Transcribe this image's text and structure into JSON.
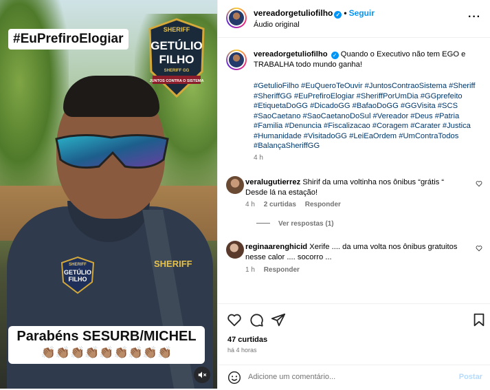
{
  "media": {
    "tag_top": "#EuPrefiroElogiar",
    "badge": {
      "top": "SHERIFF",
      "line1": "GETÚLIO",
      "line2": "FILHO",
      "middle": "SHERIFF GG",
      "bottom": "JUNTOS CONTRA O SISTEMA"
    },
    "shirt_text": "SHERIFF",
    "shirt_badge": {
      "top": "SHERIFF",
      "line1": "GETÚLIO",
      "line2": "FILHO"
    },
    "caption_line1": "Parabéns SESURB/MICHEL",
    "caption_line2": "👏🏽👏🏽👏🏽👏🏽👏🏽👏🏽👏🏽👏🏽👏🏽",
    "mute_icon": "muted-speaker-icon"
  },
  "header": {
    "username": "vereadorgetuliofilho",
    "follow_label": "Seguir",
    "subtitle": "Áudio original",
    "more_icon": "more-options-icon"
  },
  "post_caption": {
    "username": "vereadorgetuliofilho",
    "text": "Quando o Executivo não tem EGO e TRABALHA todo mundo ganha!",
    "hashtags": "#GetulioFilho #EuQueroTeOuvir #JuntosContraoSistema #Sheriff #SheriffGG #EuPrefiroElogiar #SheriffPorUmDia #GGprefeito #EtiquetaDoGG #DicadoGG #BafaoDoGG #GGVisita #SCS #SaoCaetano #SaoCaetanoDoSul #Vereador #Deus #Patria #Familia #Denuncia #Fiscalizacao #Coragem #Carater #Justica #Humanidade #VisitadoGG #LeiEaOrdem #UmContraTodos #BalançaSheriffGG",
    "time": "4 h"
  },
  "comments": [
    {
      "username": "veralugutierrez",
      "text": "Shirif da uma voltinha nos ônibus “grátis “ Desde lá na estação!",
      "time": "4 h",
      "likes": "2 curtidas",
      "reply_label": "Responder",
      "view_replies": "Ver respostas (1)"
    },
    {
      "username": "reginaarenghicid",
      "text": "Xerife .... da uma volta nos ônibus gratuitos nesse calor .... socorro ...",
      "time": "1 h",
      "reply_label": "Responder"
    }
  ],
  "actions": {
    "likes": "47 curtidas",
    "post_time": "há 4 horas",
    "comment_placeholder": "Adicione um comentário...",
    "post_label": "Postar"
  },
  "colors": {
    "accent": "#0095f6",
    "hashtag": "#00376b",
    "muted": "#737373"
  }
}
